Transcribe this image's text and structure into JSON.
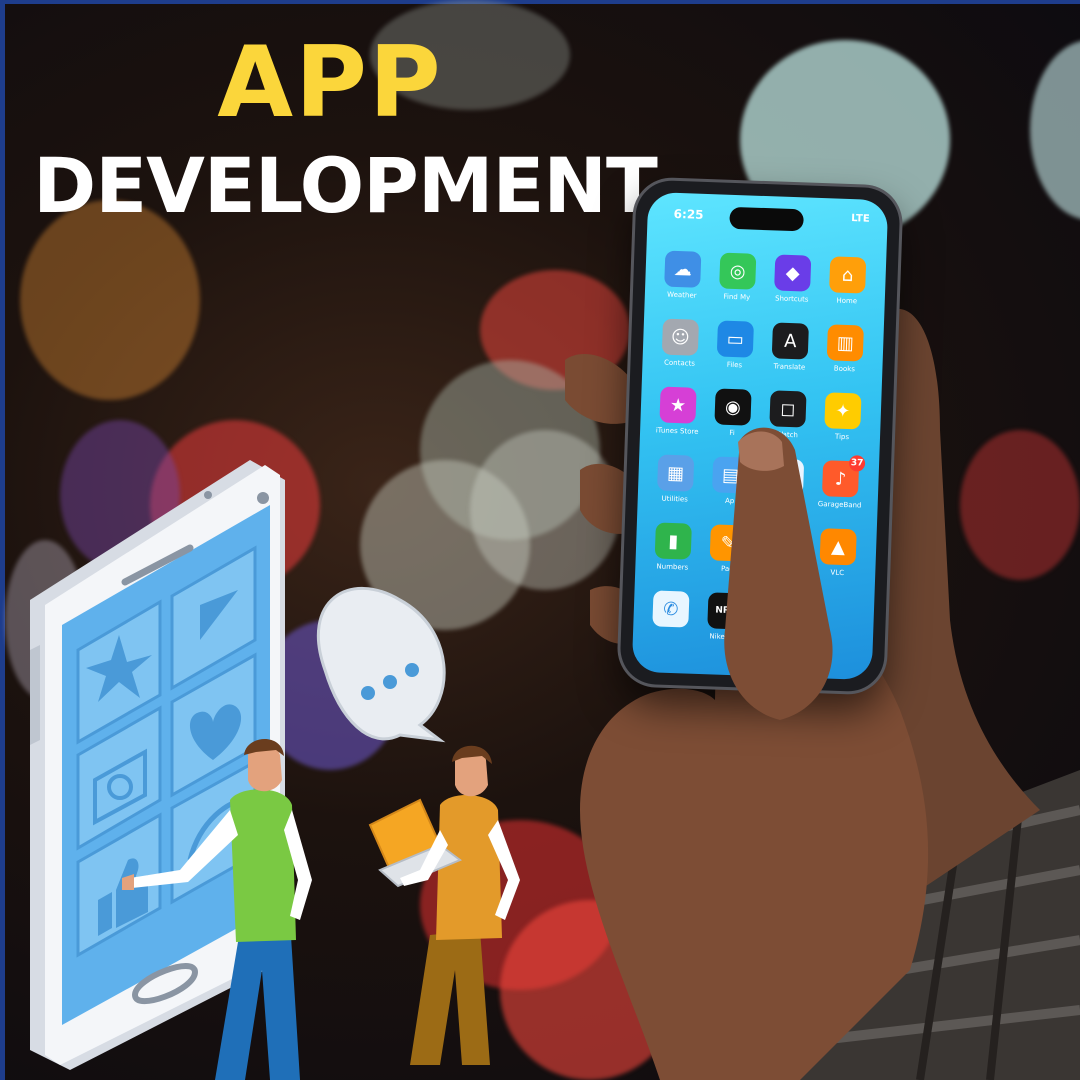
{
  "headline": {
    "line1": "APP",
    "line2": "DEVELOPMENT",
    "line1_color": "#fbd63b",
    "line2_color": "#ffffff"
  },
  "phone": {
    "status_time": "6:25",
    "status_right": "LTE",
    "apps": [
      {
        "label": "Weather",
        "icon": "weather-icon",
        "glyph": "☁",
        "color": "#3f8fe6"
      },
      {
        "label": "Find My",
        "icon": "find-my-icon",
        "glyph": "◎",
        "color": "#34c759"
      },
      {
        "label": "Shortcuts",
        "icon": "shortcuts-icon",
        "glyph": "◆",
        "color": "#6a3de8"
      },
      {
        "label": "Home",
        "icon": "home-icon",
        "glyph": "⌂",
        "color": "#ff9f0a"
      },
      {
        "label": "Contacts",
        "icon": "contacts-icon",
        "glyph": "☺",
        "color": "#a3a8b0"
      },
      {
        "label": "Files",
        "icon": "files-icon",
        "glyph": "▭",
        "color": "#1e88e5"
      },
      {
        "label": "Translate",
        "icon": "translate-icon",
        "glyph": "A",
        "color": "#1c1c1e"
      },
      {
        "label": "Books",
        "icon": "books-icon",
        "glyph": "▥",
        "color": "#ff8c00"
      },
      {
        "label": "iTunes Store",
        "icon": "itunes-store-icon",
        "glyph": "★",
        "color": "#d63fd6"
      },
      {
        "label": "Fi",
        "icon": "fitness-icon",
        "glyph": "◉",
        "color": "#111111"
      },
      {
        "label": "Watch",
        "icon": "watch-icon",
        "glyph": "◻",
        "color": "#1c1c1e"
      },
      {
        "label": "Tips",
        "icon": "tips-icon",
        "glyph": "✦",
        "color": "#ffcc00"
      },
      {
        "label": "Utilities",
        "icon": "utilities-folder-icon",
        "glyph": "▦",
        "color": "#5aa0e8"
      },
      {
        "label": "Ap",
        "icon": "app-icon",
        "glyph": "▤",
        "color": "#4aa3f0"
      },
      {
        "label": "",
        "icon": "facetime-icon",
        "glyph": "▶",
        "color": "#eaf4ff"
      },
      {
        "label": "GarageBand",
        "icon": "garageband-icon",
        "glyph": "♪",
        "color": "#ff5a2a",
        "badge": "37"
      },
      {
        "label": "Numbers",
        "icon": "numbers-icon",
        "glyph": "▮",
        "color": "#2fb44c"
      },
      {
        "label": "Pag",
        "icon": "pages-icon",
        "glyph": "✎",
        "color": "#ff9500"
      },
      {
        "label": "",
        "icon": "blank-app-icon",
        "glyph": "",
        "color": "#33c3f2"
      },
      {
        "label": "VLC",
        "icon": "vlc-icon",
        "glyph": "▲",
        "color": "#ff8800"
      },
      {
        "label": "",
        "icon": "phone-app-icon",
        "glyph": "✆",
        "color": "#e8f6ff"
      },
      {
        "label": "Nike Run",
        "icon": "nike-run-icon",
        "glyph": "NRC",
        "color": "#111111"
      }
    ]
  }
}
